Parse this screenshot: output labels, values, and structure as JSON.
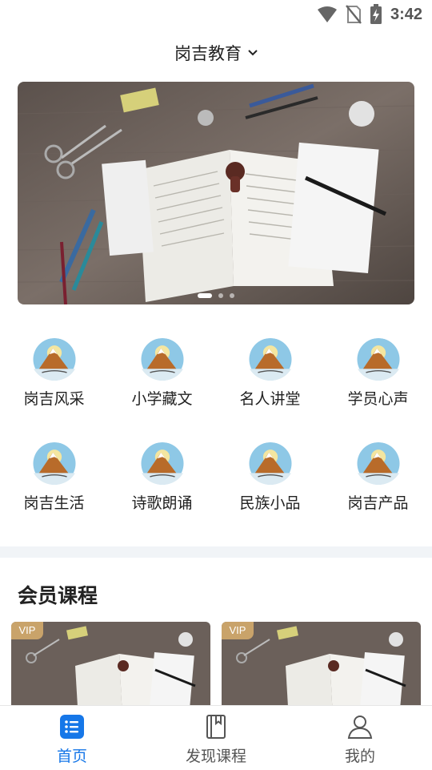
{
  "status_bar": {
    "time": "3:42"
  },
  "header": {
    "title": "岗吉教育"
  },
  "banner": {
    "dots": 3,
    "active_dot": 0
  },
  "categories": [
    {
      "label": "岗吉风采",
      "icon": "mountain-logo-icon"
    },
    {
      "label": "小学藏文",
      "icon": "mountain-logo-icon"
    },
    {
      "label": "名人讲堂",
      "icon": "mountain-logo-icon"
    },
    {
      "label": "学员心声",
      "icon": "mountain-logo-icon"
    },
    {
      "label": "岗吉生活",
      "icon": "mountain-logo-icon"
    },
    {
      "label": "诗歌朗诵",
      "icon": "mountain-logo-icon"
    },
    {
      "label": "民族小品",
      "icon": "mountain-logo-icon"
    },
    {
      "label": "岗吉产品",
      "icon": "mountain-logo-icon"
    }
  ],
  "members_section": {
    "title": "会员课程",
    "cards": [
      {
        "badge": "VIP"
      },
      {
        "badge": "VIP"
      }
    ]
  },
  "bottom_nav": {
    "items": [
      {
        "label": "首页",
        "icon": "home-list-icon",
        "active": true
      },
      {
        "label": "发现课程",
        "icon": "book-icon",
        "active": false
      },
      {
        "label": "我的",
        "icon": "user-icon",
        "active": false
      }
    ]
  },
  "colors": {
    "accent": "#1677e8",
    "vip": "#c9a36a",
    "divider": "#f1f4f7"
  }
}
